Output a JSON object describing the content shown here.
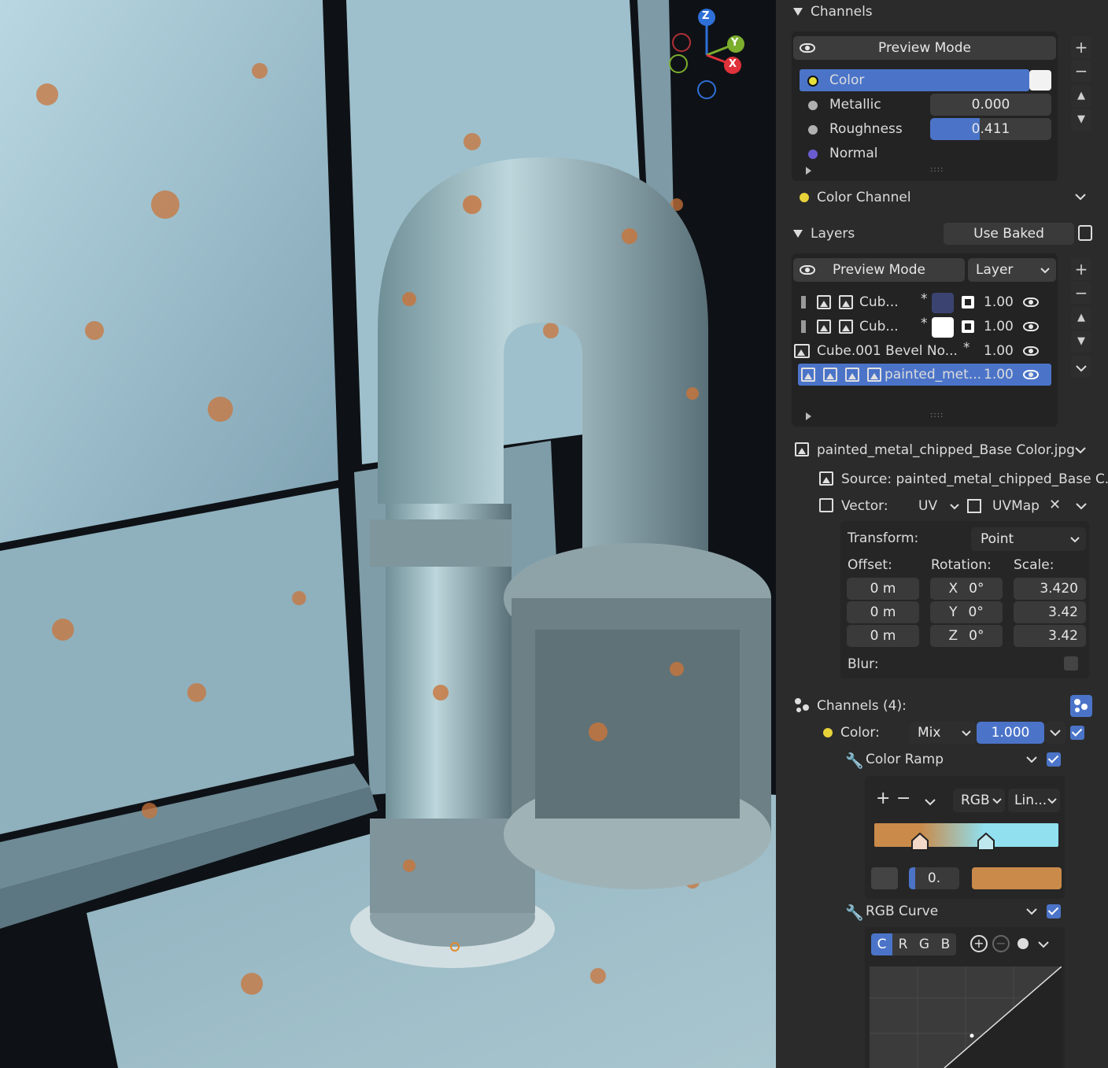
{
  "viewport": {
    "gizmo": {
      "z": "Z",
      "y": "Y",
      "x": "X"
    }
  },
  "channels": {
    "header": "Channels",
    "preview_mode": "Preview Mode",
    "items": [
      {
        "label": "Color",
        "dot_color": "#e8e03a",
        "value": "",
        "selected": true
      },
      {
        "label": "Metallic",
        "dot_color": "#b0b0b0",
        "value": "0.000"
      },
      {
        "label": "Roughness",
        "dot_color": "#b0b0b0",
        "value": "0.411",
        "fill": 0.411
      },
      {
        "label": "Normal",
        "dot_color": "#6a5ccf",
        "value": ""
      }
    ],
    "color_channel": "Color Channel"
  },
  "layers": {
    "header": "Layers",
    "use_baked": "Use Baked",
    "preview_mode": "Preview Mode",
    "mode": "Layer",
    "items": [
      {
        "name": "Cub...",
        "star": "*",
        "value": "1.00",
        "swatch": "#3b4470"
      },
      {
        "name": "Cub...",
        "star": "*",
        "value": "1.00",
        "swatch": "#ffffff"
      },
      {
        "name": "Cube.001 Bevel No...",
        "star": "*",
        "value": "1.00"
      },
      {
        "name": "painted_met...",
        "value": "1.00",
        "selected": true
      }
    ]
  },
  "texture": {
    "name": "painted_metal_chipped_Base Color.jpg",
    "source": "Source: painted_metal_chipped_Base C...",
    "vector_label": "Vector:",
    "vector_mode": "UV",
    "uvmap": "UVMap",
    "transform_label": "Transform:",
    "transform_value": "Point",
    "offset_label": "Offset:",
    "rotation_label": "Rotation:",
    "scale_label": "Scale:",
    "offset": [
      "0 m",
      "0 m",
      "0 m"
    ],
    "rotation": [
      {
        "axis": "X",
        "value": "0°"
      },
      {
        "axis": "Y",
        "value": "0°"
      },
      {
        "axis": "Z",
        "value": "0°"
      }
    ],
    "scale": [
      "3.420",
      "3.42",
      "3.42"
    ],
    "blur_label": "Blur:"
  },
  "layer_channels": {
    "header": "Channels (4):",
    "color_label": "Color:",
    "blend": "Mix",
    "amount": "1.000",
    "color_ramp": "Color Ramp",
    "ramp_mode": "RGB",
    "ramp_interp": "Lin...",
    "ramp_pos": "0.",
    "ramp_colors": {
      "left": "#c98a4a",
      "right": "#90e0f0"
    },
    "rgb_curve": "RGB Curve",
    "curve_tabs": [
      "C",
      "R",
      "G",
      "B"
    ]
  }
}
